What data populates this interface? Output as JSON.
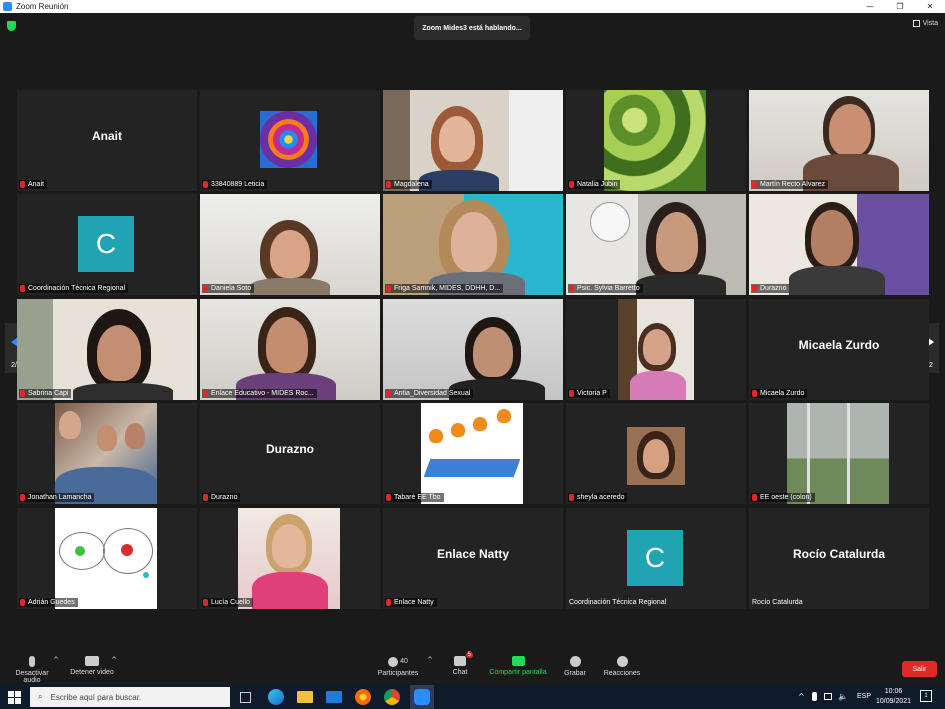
{
  "window": {
    "title": "Zoom Reunión",
    "controls": [
      "—",
      "❐",
      "✕"
    ]
  },
  "topbar": {
    "speaking": "Zoom Mides3 está hablando...",
    "view_label": "Vista"
  },
  "pager": {
    "left": "2/2",
    "right": "2/2"
  },
  "tiles": [
    {
      "name": "Anait",
      "big": "Anait",
      "muted": true
    },
    {
      "name": "33840889 Leticia",
      "muted": true
    },
    {
      "name": "Magdalena",
      "muted": true
    },
    {
      "name": "Natalia Jubin",
      "muted": true
    },
    {
      "name": "Martín Recto Alvarez",
      "muted": true
    },
    {
      "name": "Coordinación Técnica Regional",
      "letter": "C",
      "muted": true
    },
    {
      "name": "Daniela Soto",
      "muted": true
    },
    {
      "name": "Friga Samnik, MIDES, DDHH, D...",
      "muted": true
    },
    {
      "name": "Psic. Sylvia Barretto",
      "muted": true
    },
    {
      "name": "Durazno",
      "muted": true
    },
    {
      "name": "Sabrina Capi",
      "muted": true
    },
    {
      "name": "Enlace Educativo - MIDES Roc...",
      "muted": true
    },
    {
      "name": "Antia_Diversidad Sexual",
      "muted": true
    },
    {
      "name": "Victoria P",
      "muted": true
    },
    {
      "name": "Micaela Zurdo",
      "big": "Micaela Zurdo",
      "muted": true
    },
    {
      "name": "Jonathan Lamancha",
      "muted": true
    },
    {
      "name": "Durazno",
      "big": "Durazno",
      "muted": true
    },
    {
      "name": "Tabaré EE Tbo",
      "muted": true
    },
    {
      "name": "sheyla aceredo",
      "muted": true
    },
    {
      "name": "EE oeste (colon)",
      "muted": true
    },
    {
      "name": "Adrián Guedes",
      "muted": true
    },
    {
      "name": "Lucía Cuello",
      "muted": true
    },
    {
      "name": "Enlace Natty",
      "big": "Enlace Natty",
      "muted": true
    },
    {
      "name": "Coordinación Técnica Regional",
      "letter": "C",
      "muted": false
    },
    {
      "name": "Rocío Catalurda",
      "big": "Rocío Catalurda",
      "muted": false
    }
  ],
  "toolbar": {
    "audio": "Desactivar audio",
    "video": "Detener video",
    "participants": "Participantes",
    "participants_count": "40",
    "chat": "Chat",
    "chat_badge": "5",
    "share": "Compartir pantalla",
    "record": "Grabar",
    "reactions": "Reacciones",
    "leave": "Salir"
  },
  "taskbar": {
    "search_placeholder": "Escribe aquí para buscar.",
    "lang": "ESP",
    "time": "10:06",
    "date": "10/09/2021",
    "notif": "1"
  },
  "colors": {
    "accent_green": "#23d959",
    "leave_red": "#e02828",
    "avatar_teal": "#20a3b3",
    "taskbar": "#0f1a2b"
  }
}
